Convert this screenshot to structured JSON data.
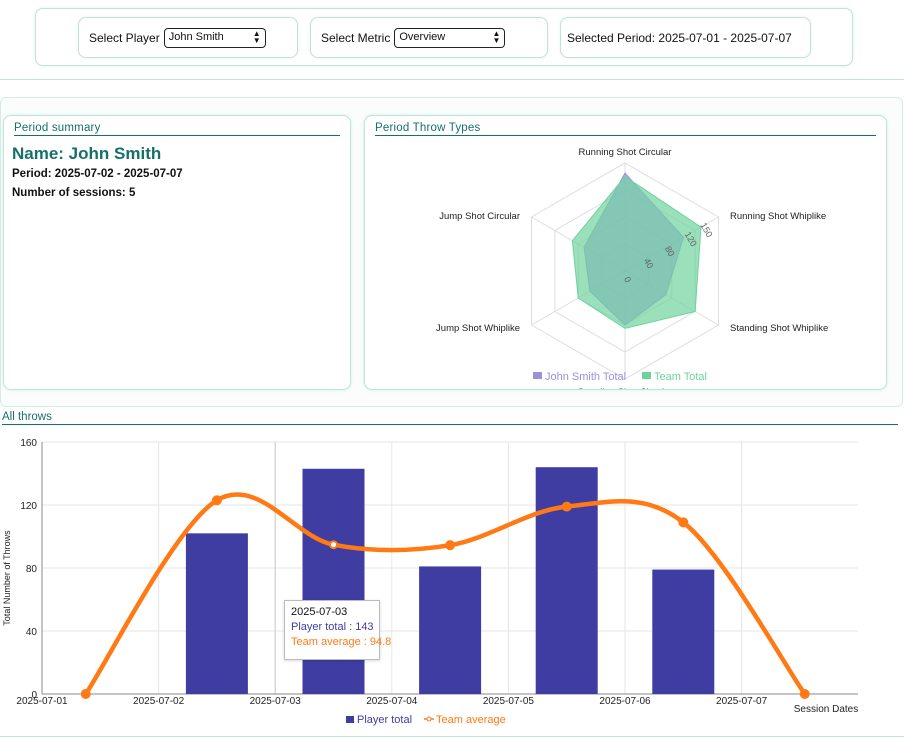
{
  "controls": {
    "player_label": "Select Player",
    "player_value": "John Smith",
    "metric_label": "Select Metric",
    "metric_value": "Overview",
    "period_text": "Selected Period: 2025-07-01 - 2025-07-07"
  },
  "summary": {
    "title": "Period summary",
    "name": "Name: John Smith",
    "period": "Period: 2025-07-02 - 2025-07-07",
    "sessions": "Number of sessions: 5"
  },
  "radar": {
    "title": "Period Throw Types",
    "axes": [
      "Running Shot Circular",
      "Running Shot Whiplike",
      "Standing Shot Whiplike",
      "Standing Shot Circular",
      "Jump Shot Whiplike",
      "Jump Shot Circular"
    ],
    "ticks": [
      "0",
      "40",
      "80",
      "120",
      "150"
    ],
    "legend": [
      "John Smith Total",
      "Team Total"
    ],
    "colors": {
      "player": "#9b8fe0",
      "team": "#6dd39e"
    }
  },
  "all_throws": {
    "title": "All throws",
    "tooltip": {
      "date": "2025-07-03",
      "player": "Player total : 143",
      "team": "Team average : 94.8"
    }
  },
  "chart_data": [
    {
      "type": "radar",
      "title": "Period Throw Types",
      "axes": [
        "Running Shot Circular",
        "Running Shot Whiplike",
        "Standing Shot Whiplike",
        "Standing Shot Circular",
        "Jump Shot Whiplike",
        "Jump Shot Circular"
      ],
      "rlim": [
        0,
        160
      ],
      "series": [
        {
          "name": "John Smith Total",
          "values": [
            145,
            100,
            70,
            80,
            60,
            70
          ]
        },
        {
          "name": "Team Total",
          "values": [
            140,
            130,
            120,
            85,
            80,
            90
          ]
        }
      ],
      "legend": "bottom"
    },
    {
      "type": "bar",
      "title": "",
      "xlabel": "Session Dates",
      "ylabel": "Total Number of Throws",
      "ylim": [
        0,
        160
      ],
      "yticks": [
        0,
        40,
        80,
        120,
        160
      ],
      "xticks": [
        "2025-07-01",
        "2025-07-02",
        "2025-07-03",
        "2025-07-04",
        "2025-07-05",
        "2025-07-06",
        "2025-07-07"
      ],
      "bars": {
        "name": "Player total",
        "color": "#3f3da1",
        "x": [
          "2025-07-02 12:00",
          "2025-07-03 12:00",
          "2025-07-04 12:00",
          "2025-07-05 12:00",
          "2025-07-06 12:00"
        ],
        "values": [
          102,
          143,
          81,
          144,
          79
        ]
      },
      "line": {
        "name": "Team average",
        "color": "#ff7a14",
        "x": [
          "2025-07-01 09:00",
          "2025-07-02 12:00",
          "2025-07-03 12:00",
          "2025-07-04 12:00",
          "2025-07-05 12:00",
          "2025-07-06 12:00",
          "2025-07-07 13:00"
        ],
        "values": [
          0,
          123,
          94.8,
          94.5,
          119,
          109,
          0
        ]
      },
      "legend": "bottom",
      "grid": true
    }
  ]
}
